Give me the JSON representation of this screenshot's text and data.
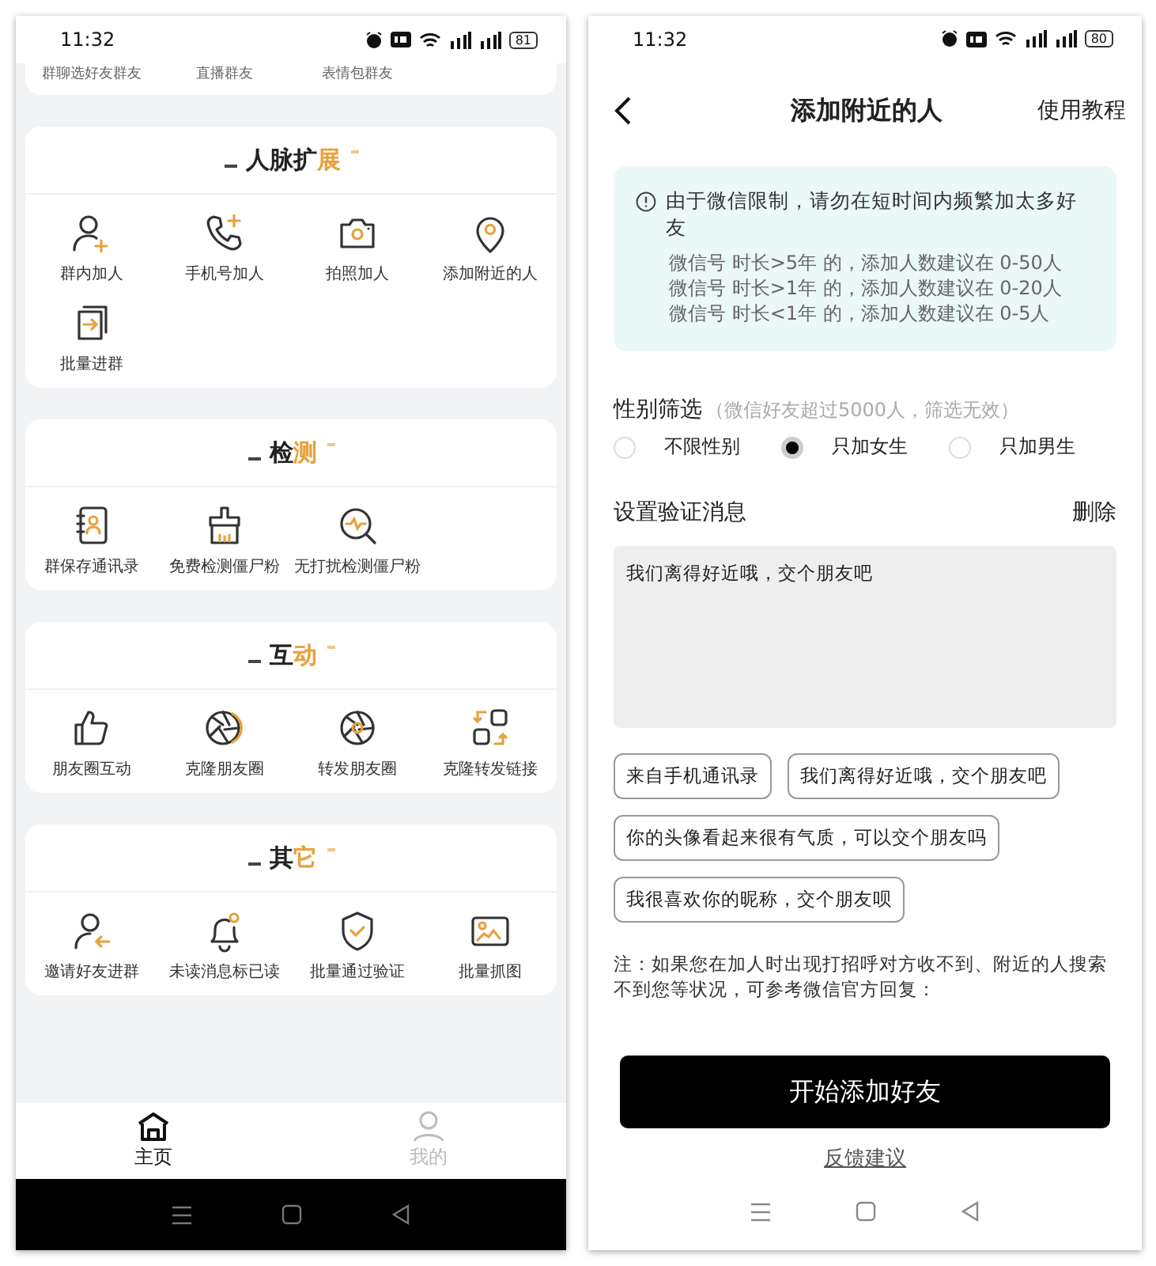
{
  "left": {
    "status_bar": {
      "time": "11:32",
      "battery": "81"
    },
    "top_card": {
      "items": [
        "群聊选好友群友",
        "直播群友",
        "表情包群友"
      ]
    },
    "sections": [
      {
        "title": "人脉扩",
        "accent": "展",
        "items": [
          "群内加人",
          "手机号加人",
          "拍照加人",
          "添加附近的人",
          "批量进群"
        ]
      },
      {
        "title": "检",
        "accent": "测",
        "items": [
          "群保存通讯录",
          "免费检测僵尸粉",
          "无打扰检测僵尸粉"
        ]
      },
      {
        "title": "互",
        "accent": "动",
        "items": [
          "朋友圈互动",
          "克隆朋友圈",
          "转发朋友圈",
          "克隆转发链接"
        ]
      },
      {
        "title": "其",
        "accent": "它",
        "items": [
          "邀请好友进群",
          "未读消息标已读",
          "批量通过验证",
          "批量抓图"
        ]
      }
    ],
    "tab_bar": [
      {
        "label": "主页",
        "selected": true
      },
      {
        "label": "我的",
        "selected": false
      }
    ]
  },
  "right": {
    "status_bar": {
      "time": "11:32",
      "battery": "80"
    },
    "header": {
      "title": "添加附近的人",
      "action": "使用教程"
    },
    "notice": {
      "headline": "由于微信限制，请勿在短时间内频繁加太多好友",
      "lines": [
        "微信号 时长>5年 的，添加人数建议在 0-50人",
        "微信号 时长>1年 的，添加人数建议在 0-20人",
        "微信号 时长<1年 的，添加人数建议在 0-5人"
      ]
    },
    "gender_filter": {
      "label": "性别筛选",
      "hint": "（微信好友超过5000人，筛选无效）",
      "options": [
        {
          "label": "不限性别",
          "selected": false
        },
        {
          "label": "只加女生",
          "selected": true
        },
        {
          "label": "只加男生",
          "selected": false
        }
      ]
    },
    "verify": {
      "label": "设置验证消息",
      "action": "删除",
      "value": "我们离得好近哦，交个朋友吧",
      "presets": [
        "来自手机通讯录",
        "我们离得好近哦，交个朋友吧",
        "你的头像看起来很有气质，可以交个朋友吗",
        "我很喜欢你的昵称，交个朋友呗"
      ]
    },
    "note": "注：如果您在加人时出现打招呼对方收不到、附近的人搜索不到您等状况，可参考微信官方回复：",
    "primary_button": "开始添加好友",
    "feedback_link": "反馈建议"
  }
}
